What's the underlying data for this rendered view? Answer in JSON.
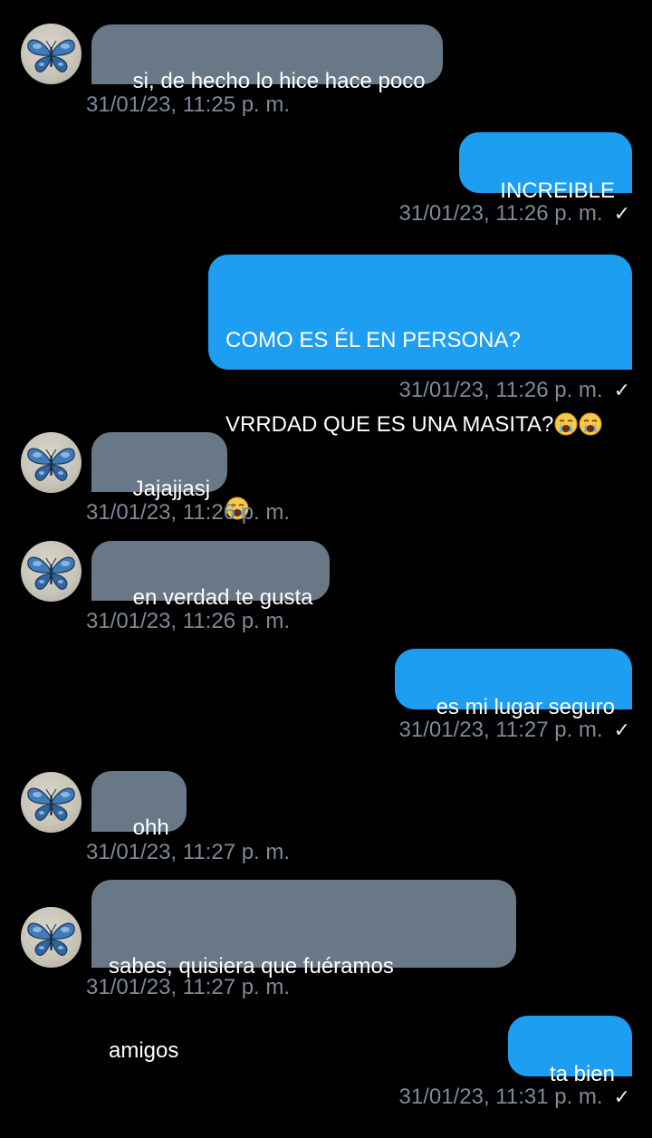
{
  "conversation": {
    "colors": {
      "background": "#000000",
      "incoming_bubble": "#697887",
      "outgoing_bubble": "#1e9ef0",
      "timestamp": "#7d8a98"
    },
    "contact_avatar_icon": "blue-butterfly-icon",
    "messages": [
      {
        "direction": "in",
        "text": "si, de hecho lo hice hace poco",
        "time": "31/01/23, 11:25 p. m."
      },
      {
        "direction": "out",
        "text": "INCREIBLE",
        "time": "31/01/23, 11:26 p. m.",
        "status_icon": "check-icon"
      },
      {
        "direction": "out",
        "text_line1": "COMO ES ÉL EN PERSONA?",
        "text_line2": "VRRDAD QUE ES UNA MASITA?",
        "emoji": "crying-face-emoji",
        "emoji_count": 3,
        "time": "31/01/23, 11:26 p. m.",
        "status_icon": "check-icon"
      },
      {
        "direction": "in",
        "text": "Jajajjasj",
        "time": "31/01/23, 11:26 p. m."
      },
      {
        "direction": "in",
        "text": "en verdad te gusta",
        "time": "31/01/23, 11:26 p. m."
      },
      {
        "direction": "out",
        "text": "es mi lugar seguro",
        "time": "31/01/23, 11:27 p. m.",
        "status_icon": "check-icon"
      },
      {
        "direction": "in",
        "text": "ohh",
        "time": "31/01/23, 11:27 p. m."
      },
      {
        "direction": "in",
        "text_line1": "sabes, quisiera que fuéramos",
        "text_line2": "amigos",
        "time": "31/01/23, 11:27 p. m."
      },
      {
        "direction": "out",
        "text": "ta bien",
        "time": "31/01/23, 11:31 p. m.",
        "status_icon": "check-icon"
      }
    ]
  }
}
